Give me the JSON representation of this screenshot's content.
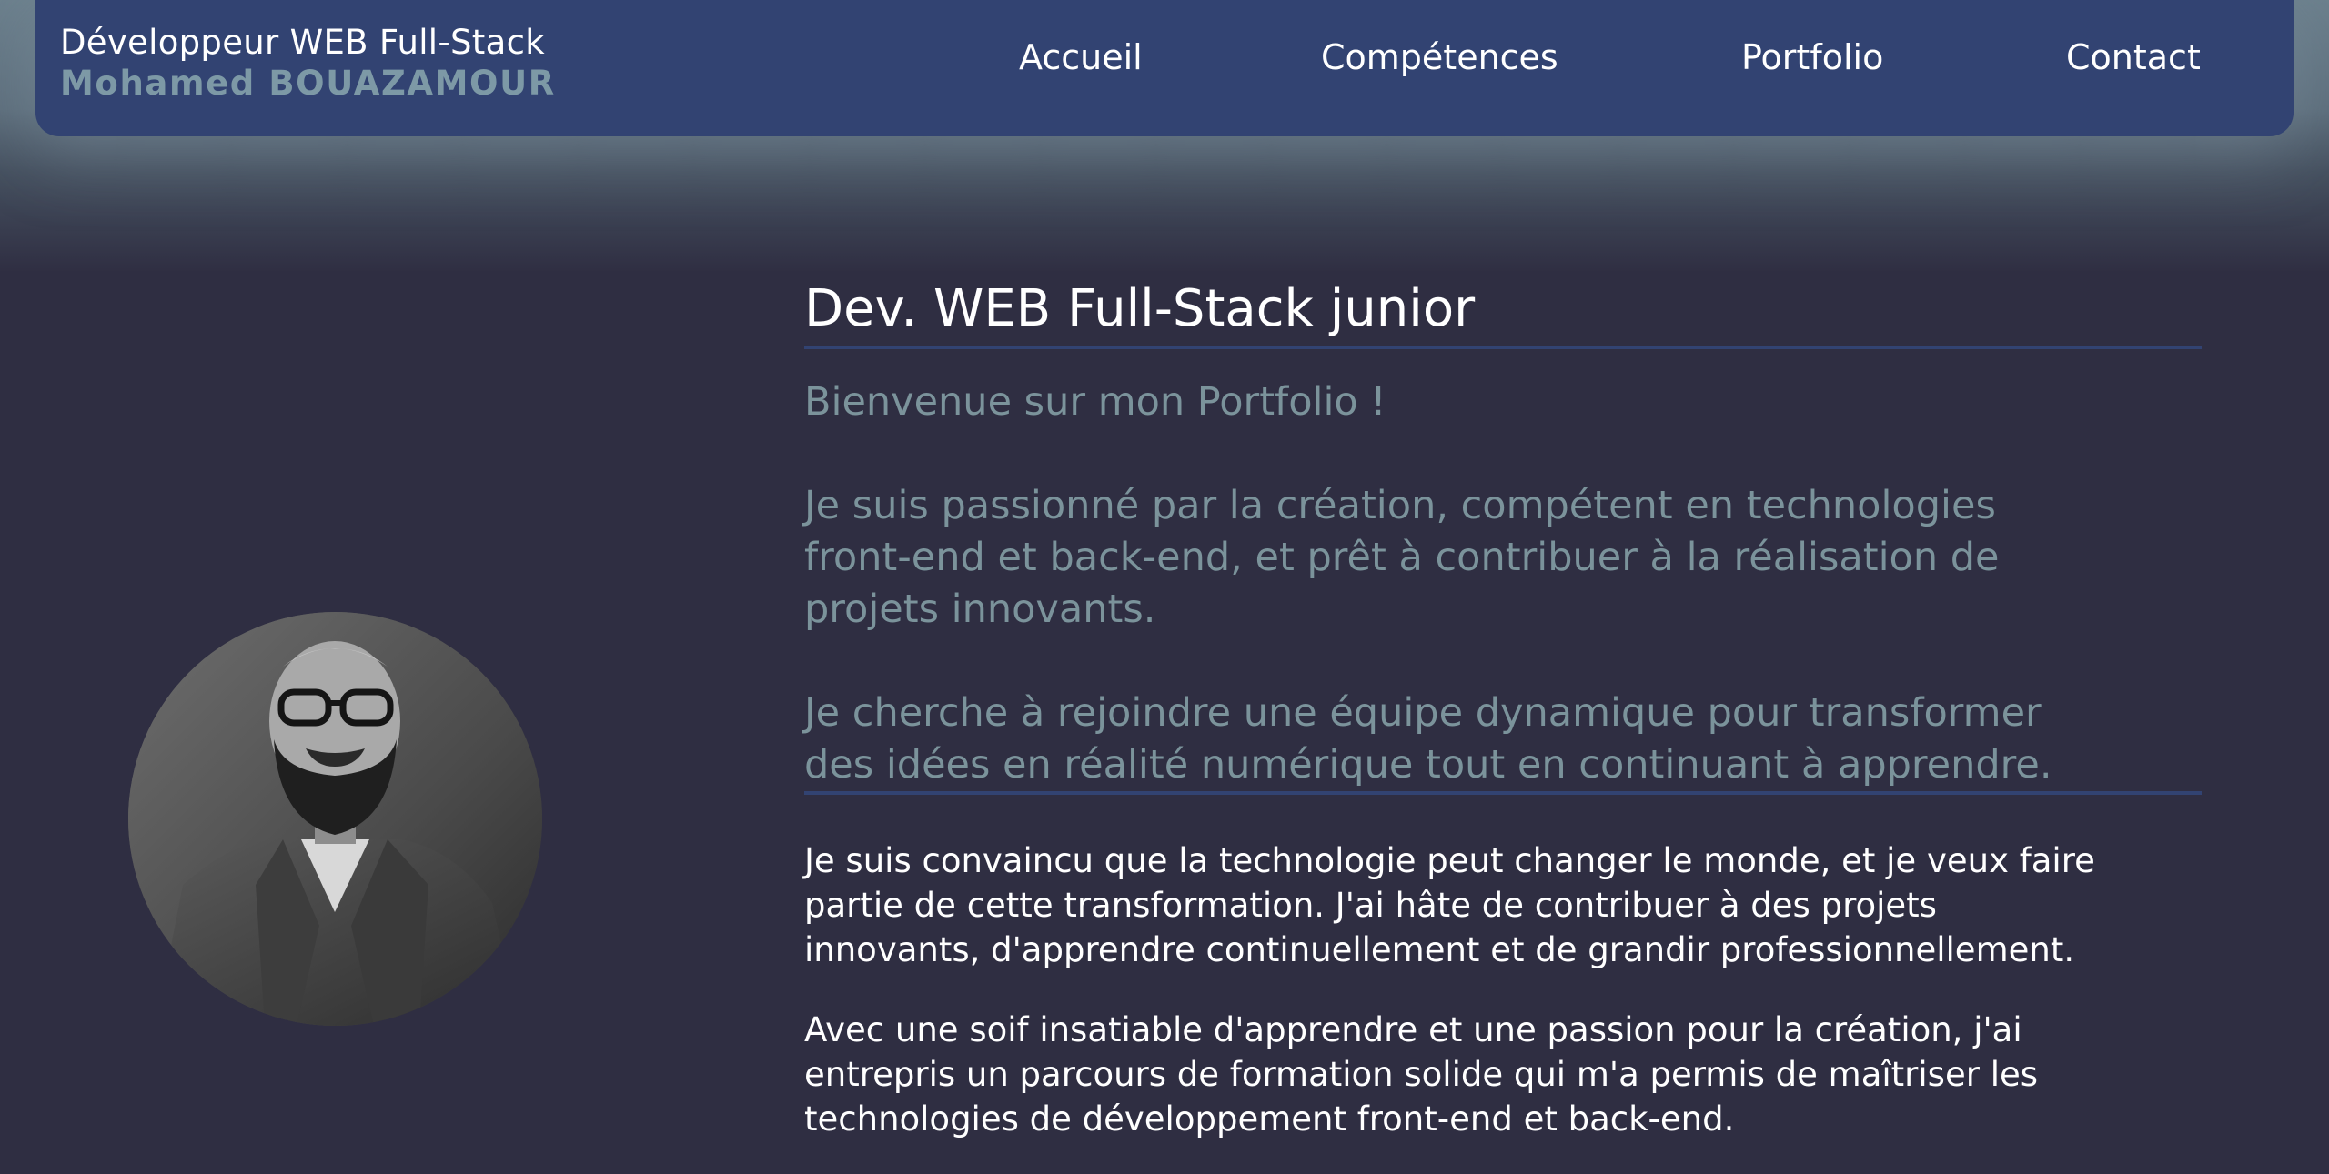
{
  "header": {
    "brand_title": "Développeur WEB Full-Stack",
    "brand_name": "Mohamed BOUAZAMOUR",
    "nav": [
      {
        "label": "Accueil"
      },
      {
        "label": "Compétences"
      },
      {
        "label": "Portfolio"
      },
      {
        "label": "Contact"
      }
    ]
  },
  "main": {
    "title": "Dev. WEB Full-Stack junior",
    "intro_lines": [
      "Bienvenue sur mon Portfolio !",
      "Je suis passionné par la création, compétent en technologies",
      "front-end et back-end, et prêt à contribuer à la réalisation de",
      "projets innovants.",
      "Je cherche à rejoindre une équipe dynamique pour transformer",
      "des idées en réalité numérique tout en continuant à apprendre."
    ],
    "paragraph1_lines": [
      "Je suis convaincu que la technologie peut changer le monde, et je veux faire",
      "partie de cette transformation. J'ai hâte de contribuer à des projets",
      "innovants, d'apprendre continuellement et de grandir professionnellement."
    ],
    "paragraph2_lines": [
      "Avec une soif insatiable d'apprendre et une passion pour la création, j'ai",
      "entrepris un parcours de formation solide qui m'a permis de maîtriser les",
      "technologies de développement front-end et back-end."
    ]
  },
  "colors": {
    "background": "#2f2e42",
    "navbar": "#324372",
    "accent_text": "#7b939b",
    "brand_name": "#7d99a6",
    "text": "#ffffff"
  }
}
